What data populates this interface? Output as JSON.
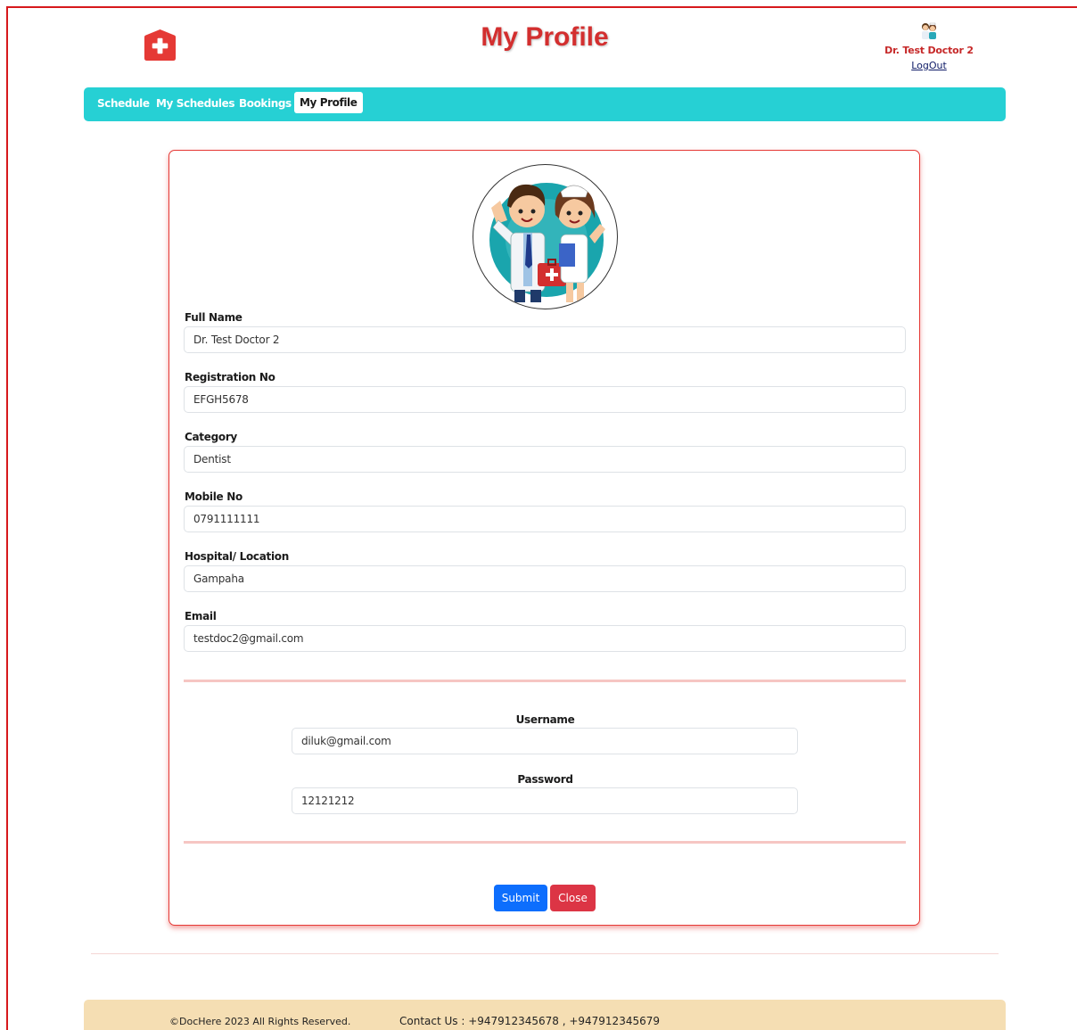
{
  "header": {
    "title": "My Profile",
    "user_name": "Dr. Test Doctor 2",
    "logout_label": "LogOut"
  },
  "nav": {
    "items": [
      {
        "label": "Schedule",
        "active": false
      },
      {
        "label": "My Schedules",
        "active": false
      },
      {
        "label": "Bookings",
        "active": false
      },
      {
        "label": "My Profile",
        "active": true
      }
    ]
  },
  "profile": {
    "fields": [
      {
        "label": "Full Name",
        "value": "Dr. Test Doctor 2"
      },
      {
        "label": "Registration No",
        "value": "EFGH5678"
      },
      {
        "label": "Category",
        "value": "Dentist"
      },
      {
        "label": "Mobile No",
        "value": "0791111111"
      },
      {
        "label": "Hospital/ Location",
        "value": "Gampaha"
      },
      {
        "label": "Email",
        "value": "testdoc2@gmail.com"
      }
    ],
    "credentials": {
      "username_label": "Username",
      "username_value": "diluk@gmail.com",
      "password_label": "Password",
      "password_value": "12121212"
    },
    "buttons": {
      "submit": "Submit",
      "close": "Close"
    }
  },
  "footer": {
    "copyright": "©DocHere 2023 All Rights Reserved.",
    "contact": "Contact Us : +947912345678 , +947912345679"
  },
  "colors": {
    "brand_red": "#d32f2f",
    "nav_bg": "#26d0d4",
    "submit": "#0d6efd",
    "close": "#dc3545",
    "footer_bg": "#f5deb3"
  },
  "icons": {
    "logo": "medical-cross-icon",
    "avatar": "doctor-nurse-avatar"
  }
}
